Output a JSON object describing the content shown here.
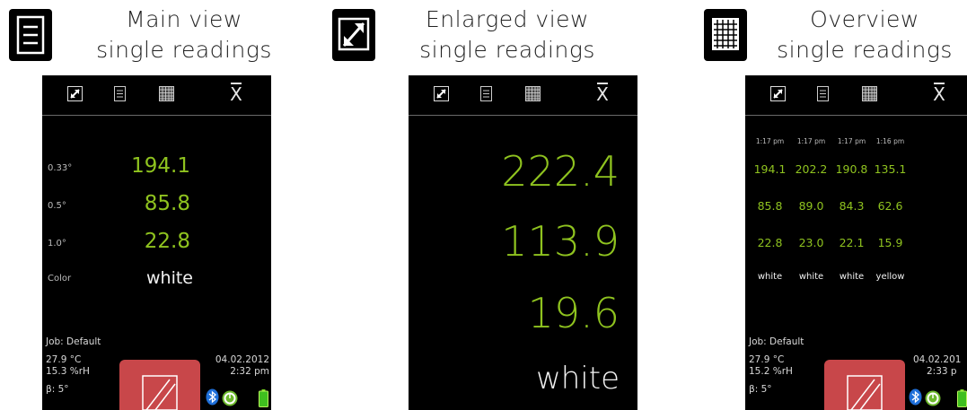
{
  "panels": [
    {
      "caption_line1": "Main view",
      "caption_line2": "single readings",
      "readings": [
        {
          "label": "0.33°",
          "value": "194.1"
        },
        {
          "label": "0.5°",
          "value": "85.8"
        },
        {
          "label": "1.0°",
          "value": "22.8"
        }
      ],
      "color_label": "Color",
      "color_value": "white",
      "job": "Job: Default",
      "temp": "27.9 °C",
      "humidity": "15.3 %rH",
      "beta": "β: 5°",
      "date": "04.02.2012",
      "time": "2:32 pm"
    },
    {
      "caption_line1": "Enlarged view",
      "caption_line2": "single readings",
      "values": [
        "222.4",
        "113.9",
        "19.6"
      ],
      "color_value": "white"
    },
    {
      "caption_line1": "Overview",
      "caption_line2": "single readings",
      "columns": [
        {
          "time": "1:17 pm",
          "v1": "194.1",
          "v2": "85.8",
          "v3": "22.8",
          "color": "white"
        },
        {
          "time": "1:17 pm",
          "v1": "202.2",
          "v2": "89.0",
          "v3": "23.0",
          "color": "white"
        },
        {
          "time": "1:17 pm",
          "v1": "190.8",
          "v2": "84.3",
          "v3": "22.1",
          "color": "white"
        },
        {
          "time": "1:16 pm",
          "v1": "135.1",
          "v2": "62.6",
          "v3": "15.9",
          "color": "yellow"
        }
      ],
      "job": "Job: Default",
      "temp": "27.9 °C",
      "humidity": "15.2 %rH",
      "beta": "β: 5°",
      "date": "04.02.201",
      "time": "2:33 p"
    }
  ],
  "toolbar": {
    "mean_symbol": "X"
  },
  "colors": {
    "reading_green": "#8fc31f",
    "logo_red": "#c8474a"
  }
}
